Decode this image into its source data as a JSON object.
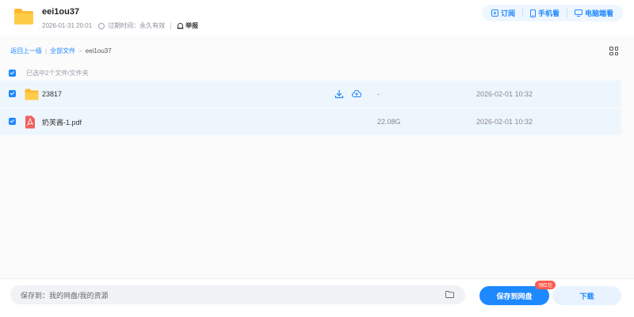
{
  "header": {
    "title": "eei1ou37",
    "date": "2026-01-31 20:01",
    "expire_label": "过期时间：永久有效",
    "report_label": "举报",
    "buttons": [
      {
        "label": "订阅",
        "icon": "subscribe-icon"
      },
      {
        "label": "手机看",
        "icon": "phone-icon"
      },
      {
        "label": "电脑端看",
        "icon": "monitor-icon"
      }
    ]
  },
  "breadcrumb": {
    "back": "返回上一级",
    "all": "全部文件",
    "sep": ">",
    "current": "eei1ou37"
  },
  "selection": {
    "text": "已选中2个文件/文件夹"
  },
  "files": [
    {
      "name": "23817",
      "type": "folder",
      "size": "-",
      "date": "2026-02-01 10:32"
    },
    {
      "name": "奶芙酱-1.pdf",
      "type": "pdf",
      "size": "22.08G",
      "date": "2026-02-01 10:32"
    }
  ],
  "footer": {
    "save_to": "保存到：我的网盘/我的资源",
    "save_button": "保存到网盘",
    "badge": "领红包",
    "download_button": "下载"
  },
  "colors": {
    "accent": "#1e88ff",
    "row_bg": "#eef6fd",
    "badge": "#ff5a4e",
    "folder": "#ffc43d",
    "pdf": "#f25e5e"
  }
}
